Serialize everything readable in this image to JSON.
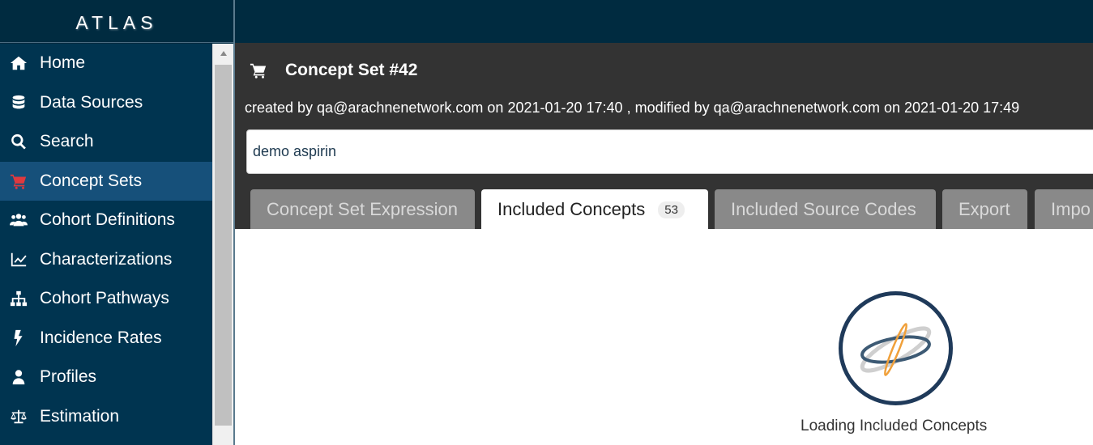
{
  "app": {
    "brand": "ATLAS"
  },
  "sidebar": {
    "items": [
      {
        "label": "Home",
        "icon": "home-icon"
      },
      {
        "label": "Data Sources",
        "icon": "database-icon"
      },
      {
        "label": "Search",
        "icon": "search-icon"
      },
      {
        "label": "Concept Sets",
        "icon": "cart-icon",
        "active": true
      },
      {
        "label": "Cohort Definitions",
        "icon": "users-icon"
      },
      {
        "label": "Characterizations",
        "icon": "line-chart-icon"
      },
      {
        "label": "Cohort Pathways",
        "icon": "sitemap-icon"
      },
      {
        "label": "Incidence Rates",
        "icon": "bolt-icon"
      },
      {
        "label": "Profiles",
        "icon": "user-icon"
      },
      {
        "label": "Estimation",
        "icon": "balance-scale-icon"
      }
    ]
  },
  "conceptSet": {
    "title": "Concept Set #42",
    "meta": "created by qa@arachnenetwork.com on 2021-01-20 17:40 , modified by qa@arachnenetwork.com on 2021-01-20 17:49",
    "name_value": "demo aspirin"
  },
  "tabs": [
    {
      "label": "Concept Set Expression"
    },
    {
      "label": "Included Concepts",
      "badge": "53",
      "active": true
    },
    {
      "label": "Included Source Codes"
    },
    {
      "label": "Export"
    },
    {
      "label": "Impo"
    }
  ],
  "content": {
    "loading_text": "Loading Included Concepts"
  },
  "colors": {
    "sidebar_bg": "#003450",
    "active_item_bg": "#16507a",
    "active_icon": "#e0393e",
    "panel_bg": "#333333"
  }
}
